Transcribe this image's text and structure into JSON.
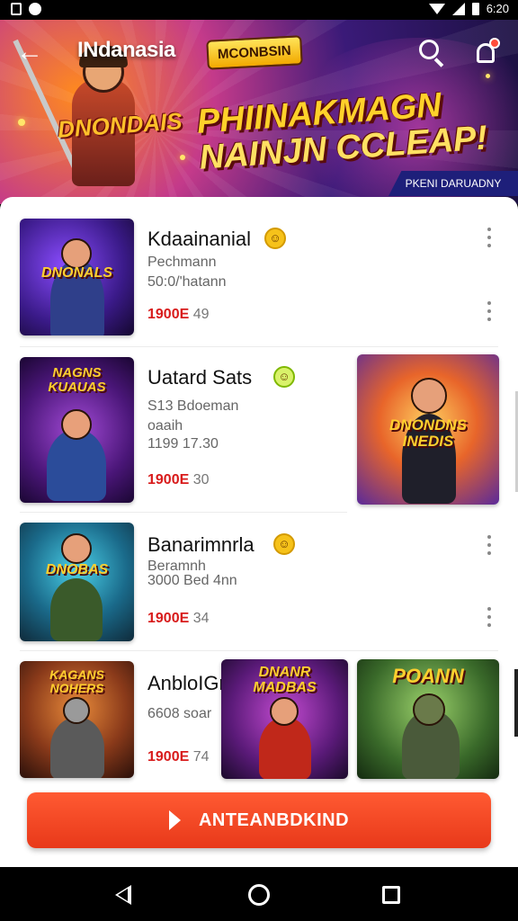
{
  "status_bar": {
    "time": "6:20"
  },
  "header": {
    "title": "INdanasia",
    "tag": "MCONBSIN",
    "hero_logo": "DNONDAIS",
    "headline_line1": "PHIINAKMAGN",
    "headline_line2": "NAINJN CCLEAP!",
    "ribbon": "PKENI DARUADNY"
  },
  "items": [
    {
      "title": "Kdaainanial",
      "sub1": "Pechmann",
      "sub2": "50:0/'hatann",
      "price_red": "1900E",
      "price_rest": "49",
      "thumb_logo": "DNONALS"
    },
    {
      "title": "Uatard Sats",
      "sub1": "S13 Bdoeman",
      "sub2": "oaaih",
      "sub3": "1199 17.30",
      "price_red": "1900E",
      "price_rest": "30",
      "thumb_logo": "NAGNS KUAUAS",
      "side_logo": "DNONDNS INEDIS"
    },
    {
      "title": "Banarimnrla",
      "sub1": "Beramnh",
      "sub2": "3000 Bed 4nn",
      "price_red": "1900E",
      "price_rest": "34",
      "thumb_logo": "DNOBAS"
    },
    {
      "title": "AnbloIGr",
      "sub1": "6608 soar",
      "price_red": "1900E",
      "price_rest": "74",
      "thumb_logo": "KAGANS NOHERS",
      "mid_logo": "DNANR MADBAS",
      "right_logo": "POANN"
    }
  ],
  "cta": {
    "label": "ANTEANBDKIND"
  },
  "colors": {
    "accent": "#e8391a",
    "price": "#d81b1b"
  }
}
